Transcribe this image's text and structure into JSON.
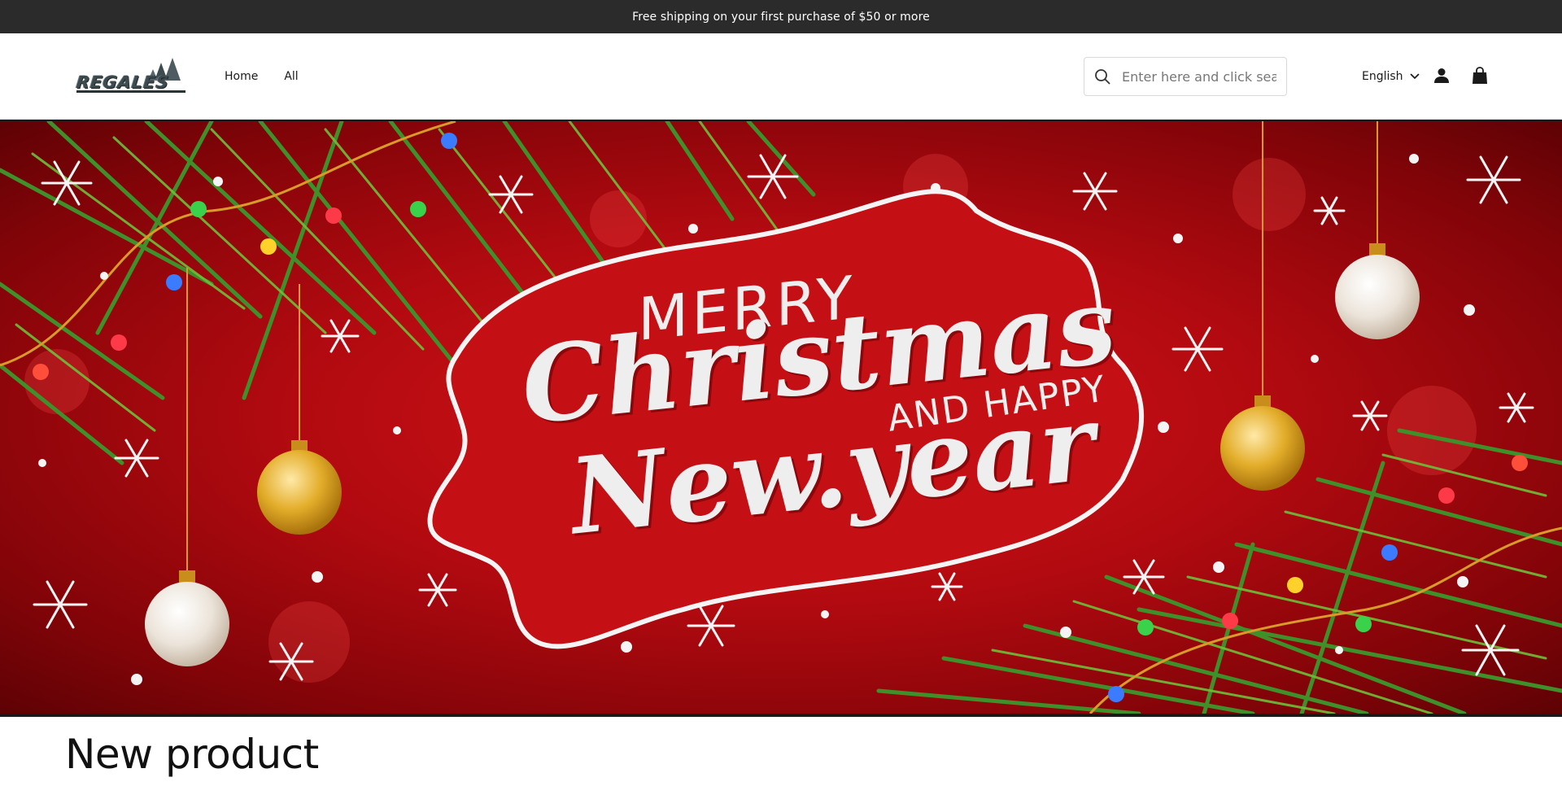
{
  "announcement": {
    "text": "Free shipping on your first purchase of $50 or more"
  },
  "header": {
    "logo_text": "REGALES",
    "nav": [
      {
        "label": "Home"
      },
      {
        "label": "All"
      }
    ],
    "search": {
      "placeholder": "Enter here and click search",
      "value": ""
    },
    "language": "English",
    "icons": {
      "search": "search-icon",
      "language_toggle": "chevron-down-icon",
      "account": "account-icon",
      "cart": "shopping-bag-icon"
    }
  },
  "hero": {
    "line1": "MERRY",
    "line2": "Christmas",
    "line3": "AND HAPPY",
    "line4": "New.year",
    "colors": {
      "background": "#c40f14",
      "lettering": "#eeeeee",
      "pine": "#3f8f2a",
      "gold": "#e3ad2a"
    }
  },
  "section": {
    "title": "New product"
  },
  "colors": {
    "announcement_bg": "#2b2b2b",
    "text": "#1a1a1a"
  }
}
